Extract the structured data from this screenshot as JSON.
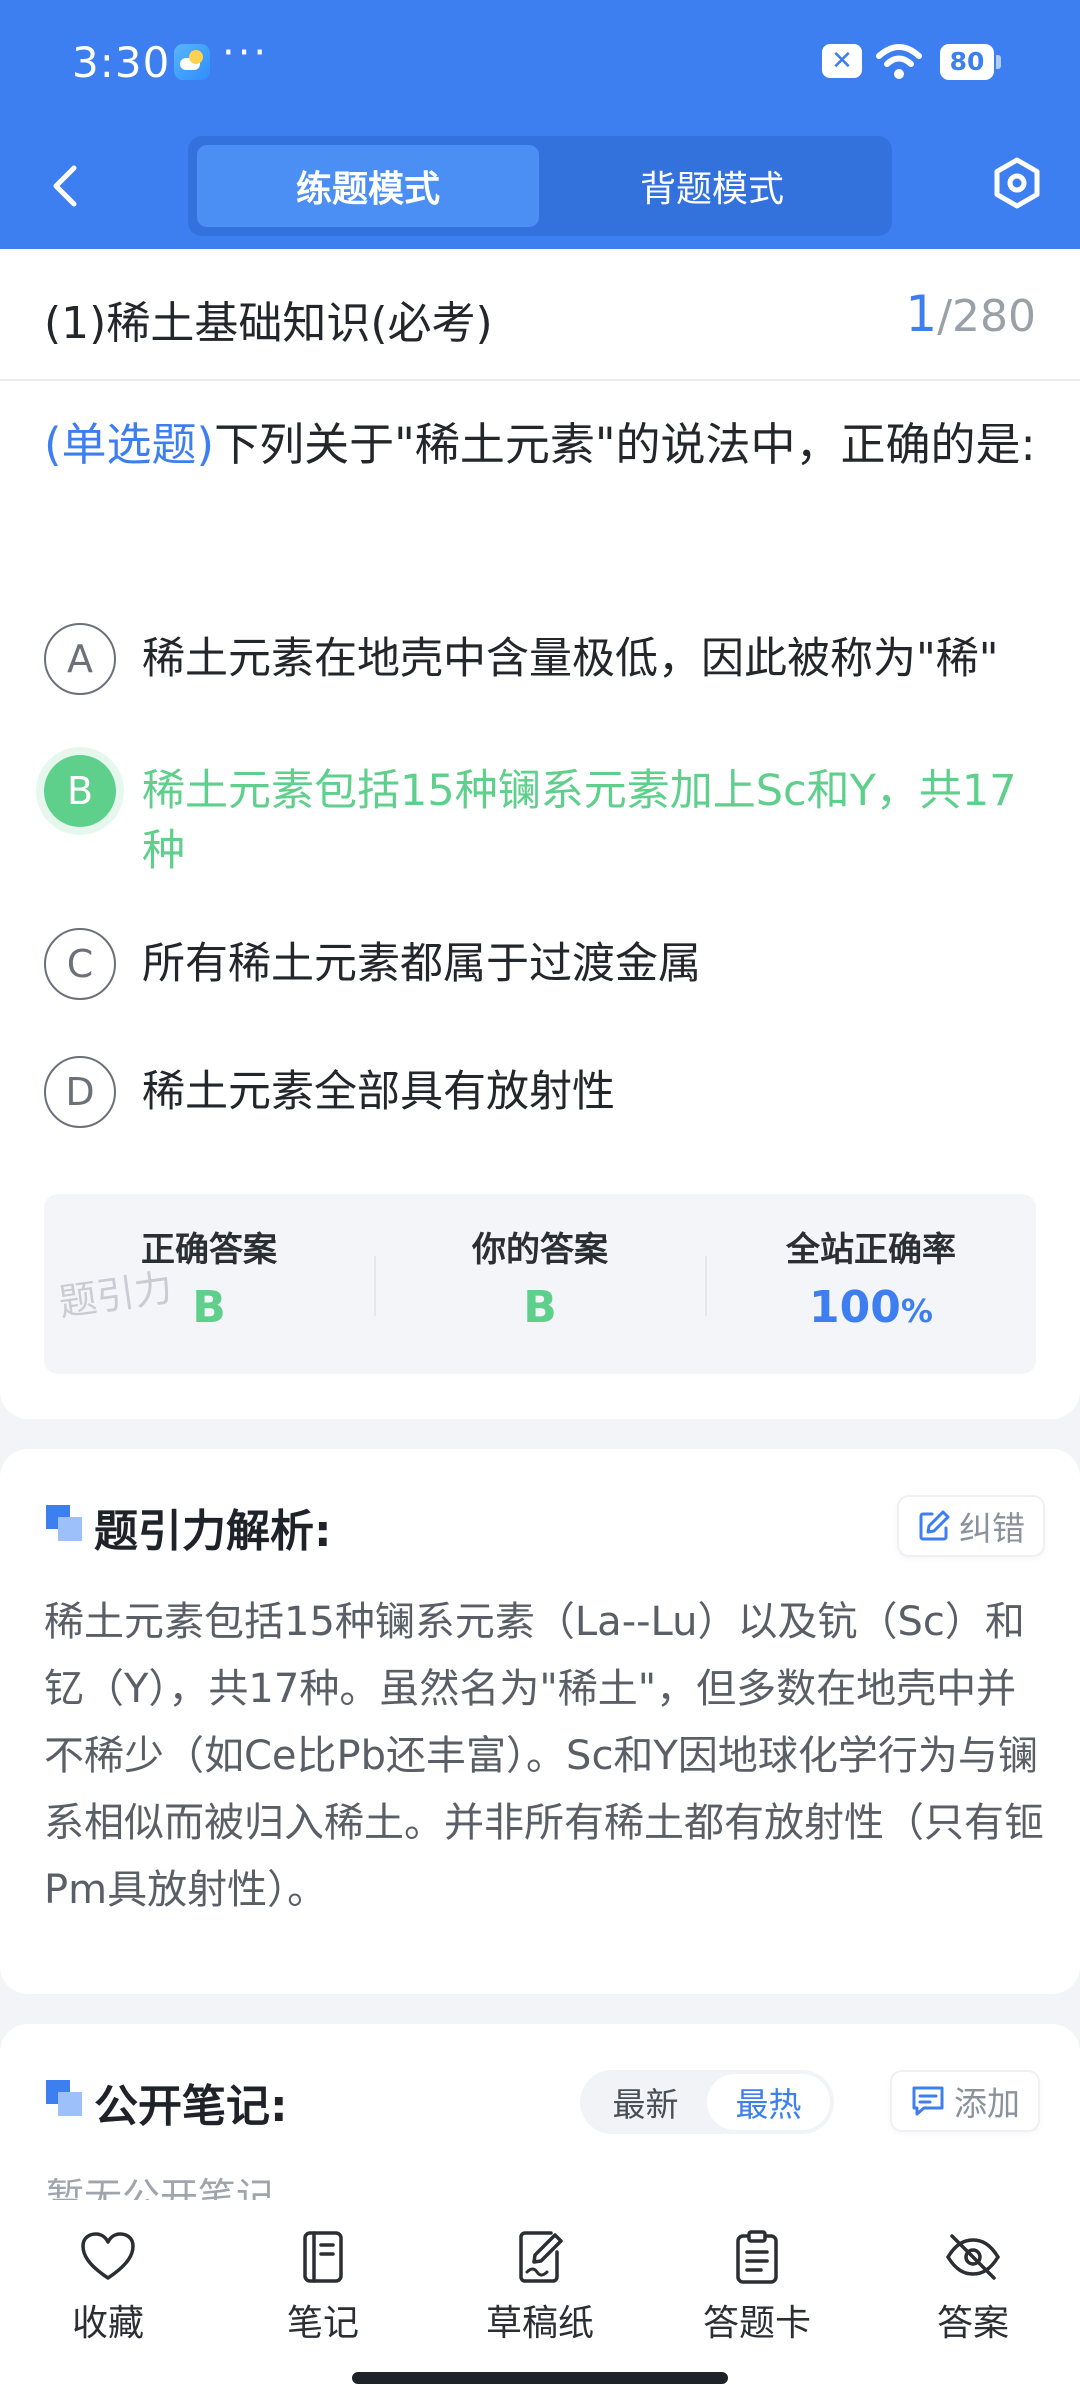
{
  "status_bar": {
    "time": "3:30",
    "dots": "···",
    "battery": "80"
  },
  "header": {
    "mode_tabs": [
      {
        "label": "练题模式",
        "active": true
      },
      {
        "label": "背题模式",
        "active": false
      }
    ]
  },
  "chapter": {
    "title": "(1)稀土基础知识(必考)",
    "current": "1",
    "total": "/280"
  },
  "question": {
    "type": "(单选题)",
    "stem": "下列关于\"稀土元素\"的说法中，正确的是:",
    "options": [
      {
        "letter": "A",
        "text": "稀土元素在地壳中含量极低，因此被称为\"稀\""
      },
      {
        "letter": "B",
        "text": "稀土元素包括15种镧系元素加上Sc和Y，共17种"
      },
      {
        "letter": "C",
        "text": "所有稀土元素都属于过渡金属"
      },
      {
        "letter": "D",
        "text": "稀土元素全部具有放射性"
      }
    ],
    "correct_option": "B"
  },
  "stats": {
    "correct_label": "正确答案",
    "correct_value": "B",
    "yours_label": "你的答案",
    "yours_value": "B",
    "rate_label": "全站正确率",
    "rate_value": "100",
    "rate_unit": "%",
    "watermark": "题引力"
  },
  "analysis": {
    "title": "题引力解析:",
    "report_label": "纠错",
    "text": "稀土元素包括15种镧系元素（La--Lu）以及钪（Sc）和钇（Y），共17种。虽然名为\"稀土\"，但多数在地壳中并不稀少（如Ce比Pb还丰富）。Sc和Y因地球化学行为与镧系相似而被归入稀土。并非所有稀土都有放射性（只有钷Pm具放射性）。"
  },
  "notes": {
    "title": "公开笔记:",
    "sort_latest": "最新",
    "sort_hot": "最热",
    "add_label": "添加",
    "empty": "暂无公开笔记"
  },
  "bottom_tabs": [
    {
      "label": "收藏",
      "icon": "heart-icon"
    },
    {
      "label": "笔记",
      "icon": "notebook-icon"
    },
    {
      "label": "草稿纸",
      "icon": "draft-icon"
    },
    {
      "label": "答题卡",
      "icon": "answer-card-icon"
    },
    {
      "label": "答案",
      "icon": "eye-off-icon"
    }
  ],
  "colors": {
    "primary": "#3d7ff0",
    "correct": "#5fcf8c"
  }
}
